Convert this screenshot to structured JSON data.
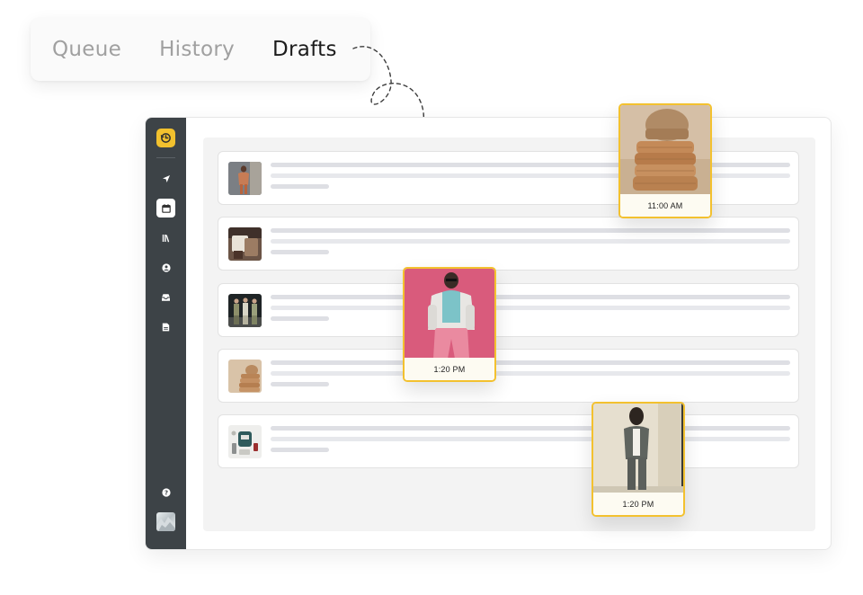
{
  "tabs": [
    {
      "label": "Queue",
      "active": false
    },
    {
      "label": "History",
      "active": false
    },
    {
      "label": "Drafts",
      "active": true
    }
  ],
  "sidebar": {
    "items": [
      {
        "icon": "send-icon",
        "active": false
      },
      {
        "icon": "calendar-icon",
        "active": true
      },
      {
        "icon": "library-icon",
        "active": false
      },
      {
        "icon": "user-circle-icon",
        "active": false
      },
      {
        "icon": "inbox-icon",
        "active": false
      },
      {
        "icon": "document-icon",
        "active": false
      }
    ],
    "bottom": [
      {
        "icon": "help-icon"
      },
      {
        "icon": "avatar"
      }
    ]
  },
  "posts": [
    {
      "thumb": "woman-orange-outfit"
    },
    {
      "thumb": "knit-sweaters-and-bags"
    },
    {
      "thumb": "three-men-street"
    },
    {
      "thumb": "stacked-beanies"
    },
    {
      "thumb": "product-flatlay"
    }
  ],
  "scheduled": [
    {
      "image": "stacked-beanies",
      "time": "11:00 AM"
    },
    {
      "image": "model-pink-backdrop",
      "time": "1:20 PM"
    },
    {
      "image": "model-grey-suit",
      "time": "1:20 PM"
    }
  ],
  "colors": {
    "accent": "#f3c12f",
    "sidebar": "#3d4347",
    "panel": "#f3f3f3",
    "placeholder_line": "#dedfe4"
  }
}
